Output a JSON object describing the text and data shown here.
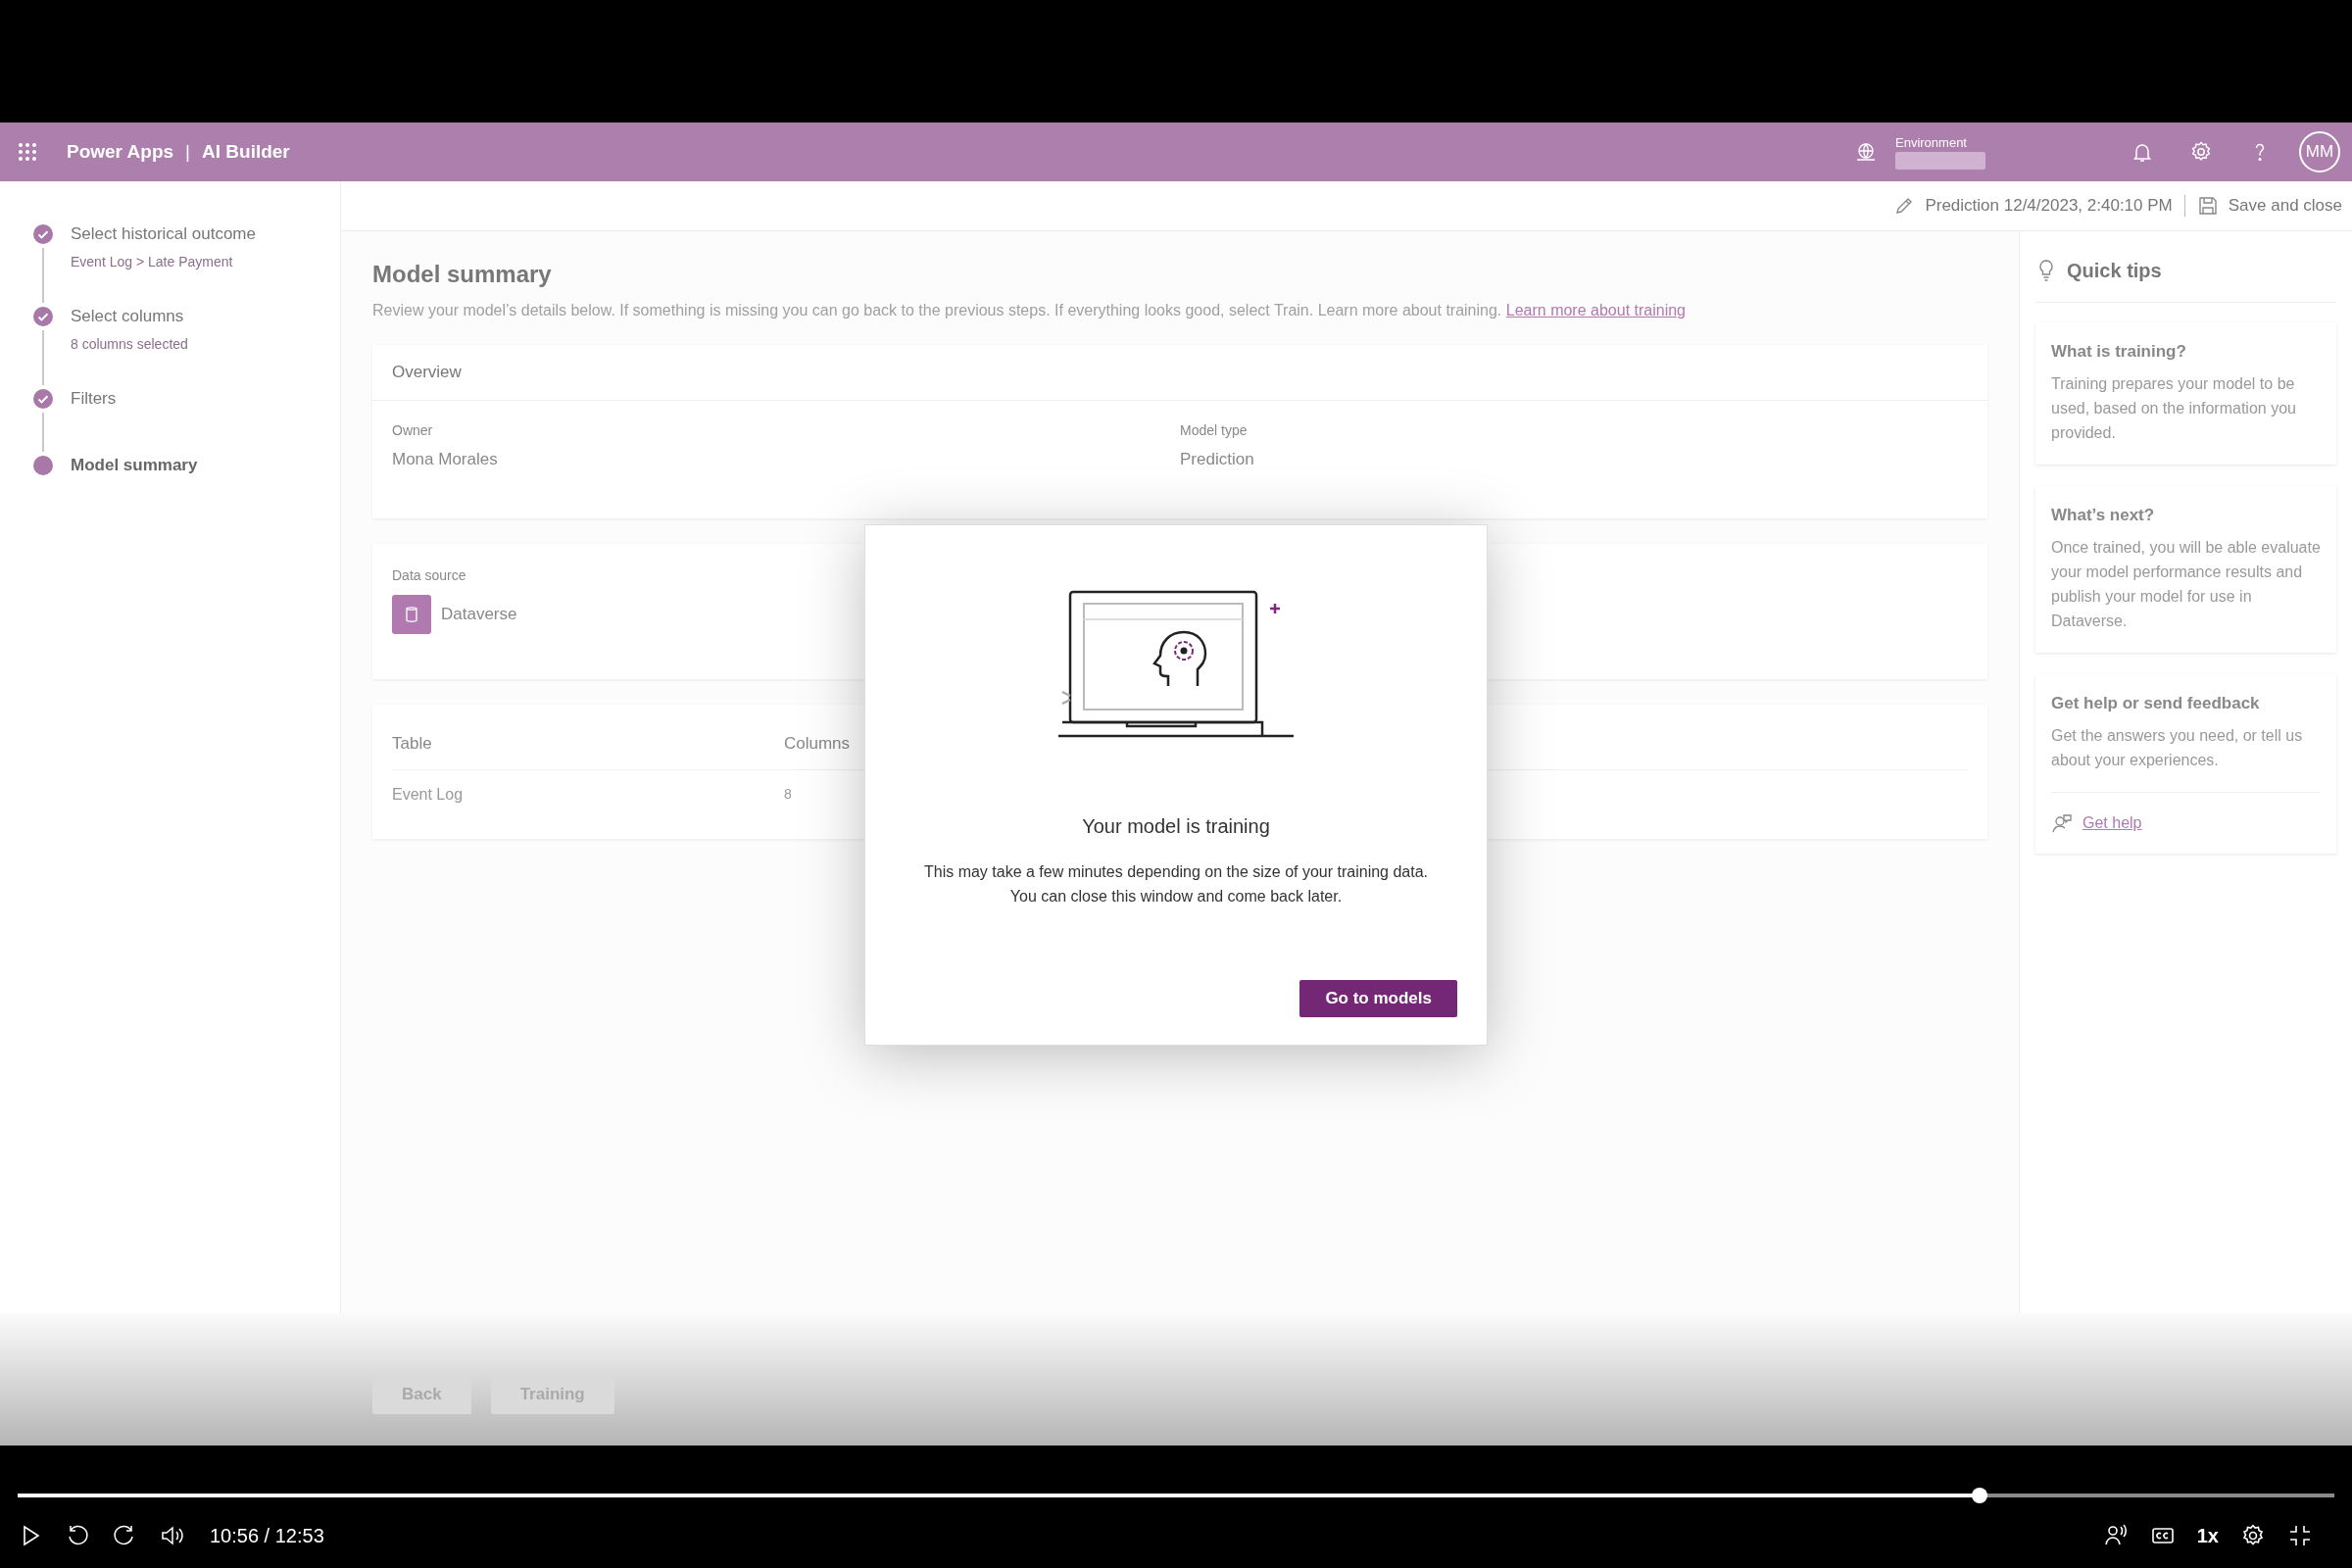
{
  "header": {
    "app_name": "Power Apps",
    "separator": "|",
    "section": "AI Builder",
    "environment_label": "Environment",
    "avatar": "MM"
  },
  "command_bar": {
    "model_name": "Prediction 12/4/2023, 2:40:10 PM",
    "save": "Save and close"
  },
  "steps": [
    {
      "label": "Select historical outcome",
      "detail": "Event Log > Late Payment",
      "completed": true
    },
    {
      "label": "Select columns",
      "detail": "8 columns selected",
      "completed": true
    },
    {
      "label": "Filters",
      "completed": true
    },
    {
      "label": "Model summary",
      "completed": false
    }
  ],
  "main": {
    "title": "Model summary",
    "description": "Review your model’s details below. If something is missing you can go back to the previous steps. If everything looks good, select Train. Learn more about training.",
    "link": "Learn more about training",
    "overview": {
      "heading": "Overview",
      "fields": [
        {
          "label": "Owner",
          "value": "Mona Morales"
        },
        {
          "label": "Model type",
          "value": "Prediction"
        }
      ]
    },
    "data_source": {
      "label": "Data source",
      "value": "Dataverse"
    },
    "table": {
      "columns": [
        "Table",
        "Columns"
      ],
      "rows": [
        [
          "Event Log",
          "8"
        ]
      ]
    },
    "buttons": [
      "Back",
      "Training"
    ]
  },
  "quick_tips": {
    "title": "Quick tips",
    "cards": [
      {
        "title": "What is training?",
        "text": "Training prepares your model to be used, based on the information you provided."
      },
      {
        "title": "What’s next?",
        "text": "Once trained, you will be able evaluate your model performance results and publish your model for use in Dataverse."
      },
      {
        "title": "Get help or send feedback",
        "text": "Get the answers you need, or tell us about your experiences.",
        "link": "Get help"
      }
    ]
  },
  "dialog": {
    "title": "Your model is training",
    "lines": [
      "This may take a few minutes depending on the size of your training data.",
      "You can close this window and come back later."
    ],
    "button": "Go to models"
  },
  "video_player": {
    "progress": {
      "level": 0.847
    },
    "time": "10:56 / 12:53",
    "speed": "1x"
  }
}
